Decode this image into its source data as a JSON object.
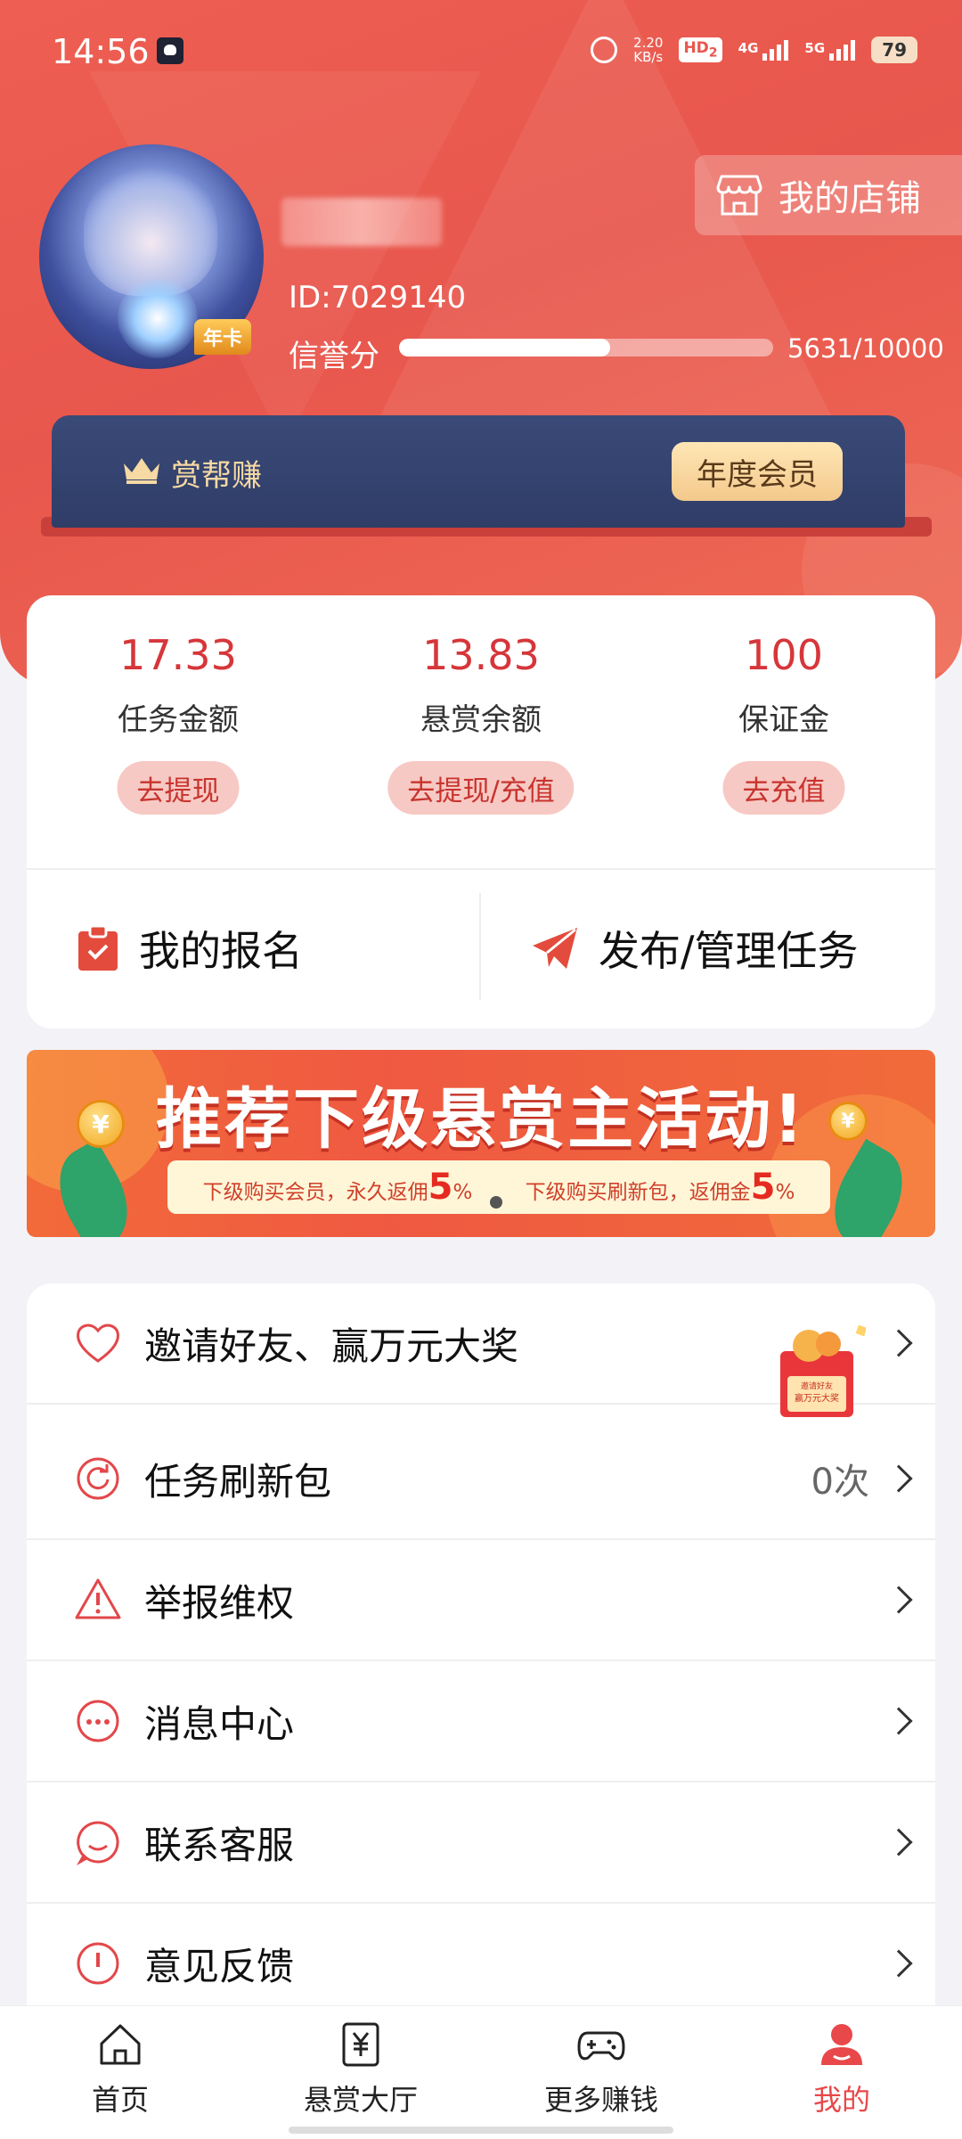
{
  "status_bar": {
    "time": "14:56",
    "net_speed": "2.20",
    "net_unit": "KB/s",
    "hd": "HD",
    "hd_sub": "2",
    "net1": "4G",
    "net2": "5G",
    "battery": "79"
  },
  "profile": {
    "id": "ID:7029140",
    "badge": "年卡",
    "credit_label": "信誉分",
    "credit_value_text": "5631/10000",
    "credit_fraction": 0.5631,
    "shop_label": "我的店铺"
  },
  "vip": {
    "name": "赏帮赚",
    "button": "年度会员"
  },
  "balances": [
    {
      "value": "17.33",
      "label": "任务金额",
      "action": "去提现"
    },
    {
      "value": "13.83",
      "label": "悬赏余额",
      "action": "去提现/充值"
    },
    {
      "value": "100",
      "label": "保证金",
      "action": "去充值"
    }
  ],
  "quick_actions": {
    "signup": "我的报名",
    "publish": "发布/管理任务"
  },
  "banner": {
    "title": "推荐下级悬赏主活动!",
    "left_text": "下级购买会员，永久返佣",
    "left_pct": "5",
    "right_text": "下级购买刷新包，返佣金",
    "right_pct": "5",
    "pct_sign": "%",
    "coin_symbol": "¥"
  },
  "menu": [
    {
      "label": "邀请好友、赢万元大奖",
      "icon": "heart-icon"
    },
    {
      "label": "任务刷新包",
      "extra": "0次",
      "icon": "refresh-icon"
    },
    {
      "label": "举报维权",
      "icon": "warning-icon"
    },
    {
      "label": "消息中心",
      "icon": "message-icon"
    },
    {
      "label": "联系客服",
      "icon": "service-icon"
    },
    {
      "label": "意见反馈",
      "icon": "feedback-icon"
    }
  ],
  "gift": {
    "line1": "邀请好友",
    "line2": "赢万元大奖"
  },
  "nav": [
    {
      "label": "首页",
      "icon": "home-icon"
    },
    {
      "label": "悬赏大厅",
      "icon": "reward-hall-icon"
    },
    {
      "label": "更多赚钱",
      "icon": "gamepad-icon"
    },
    {
      "label": "我的",
      "icon": "profile-icon",
      "active": true
    }
  ],
  "colors": {
    "brand_red": "#e8574d",
    "accent_red": "#d6363a",
    "vip_navy": "#3a4a78",
    "vip_gold": "#f6d9a3"
  }
}
